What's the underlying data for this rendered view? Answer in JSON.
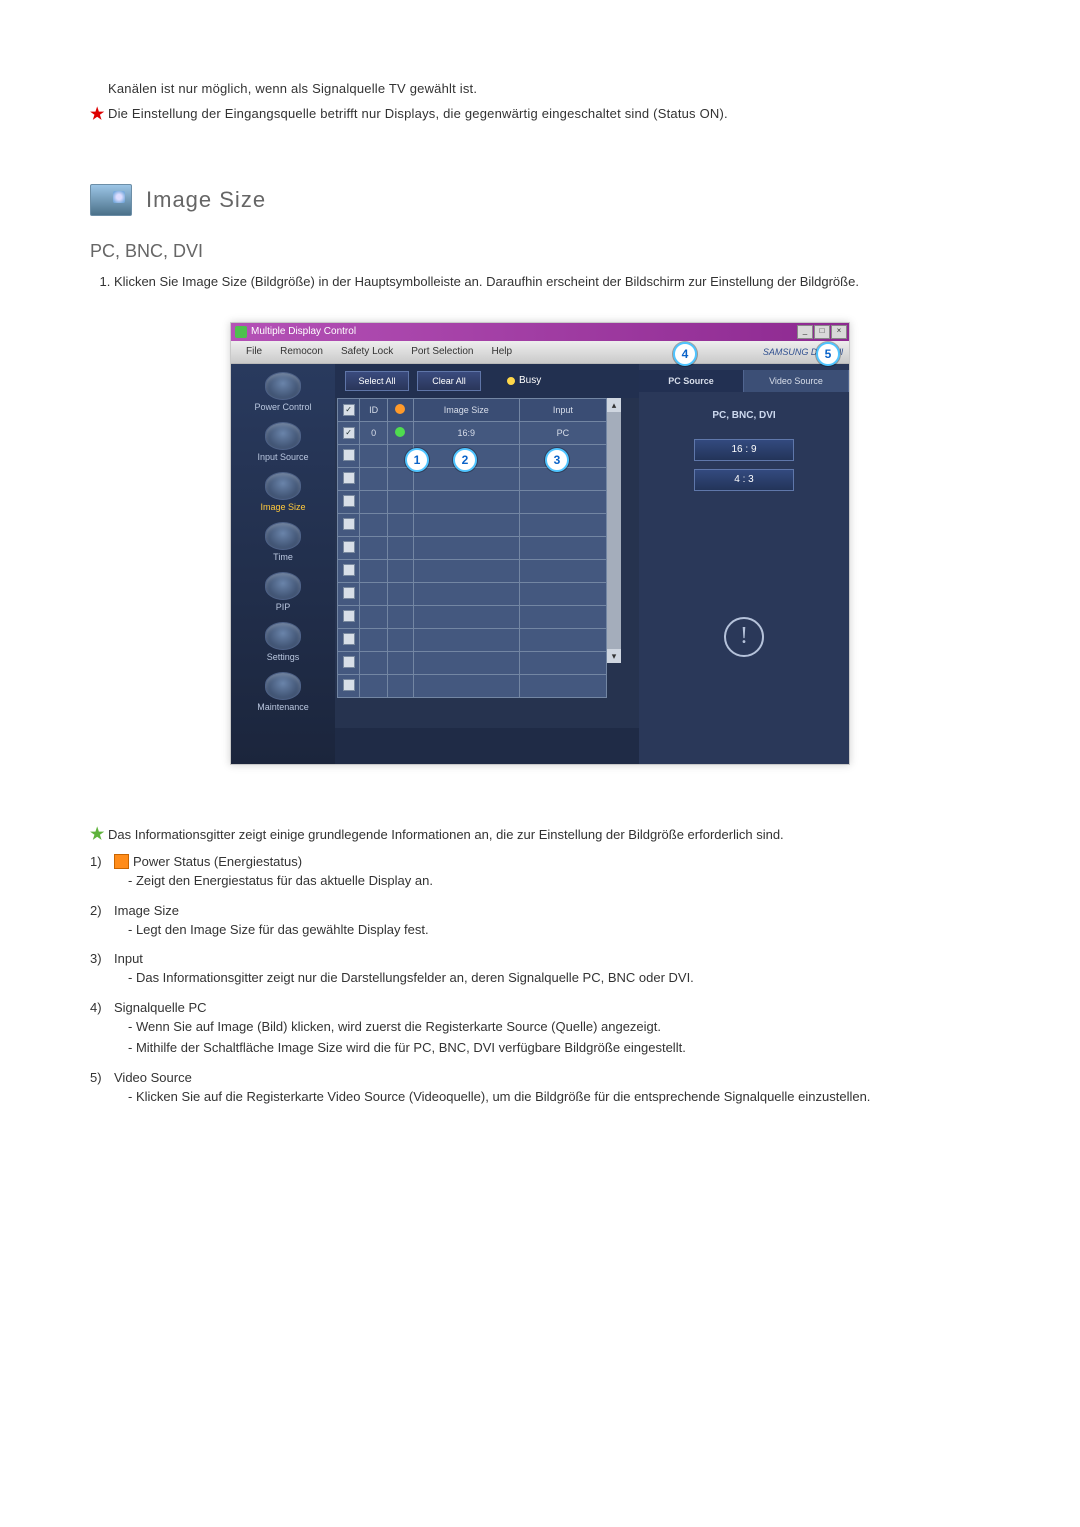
{
  "intro": {
    "line1": "Kanälen ist nur möglich, wenn als Signalquelle TV gewählt ist.",
    "line2": "Die Einstellung der Eingangsquelle betrifft nur Displays, die gegenwärtig eingeschaltet sind (Status ON)."
  },
  "section": {
    "title": "Image Size",
    "subhead": "PC, BNC, DVI",
    "step1": "Klicken Sie Image Size (Bildgröße) in der Hauptsymbolleiste an. Daraufhin erscheint der Bildschirm zur Einstellung der Bildgröße."
  },
  "mock": {
    "title": "Multiple Display Control",
    "menu": [
      "File",
      "Remocon",
      "Safety Lock",
      "Port Selection",
      "Help"
    ],
    "brand": "SAMSUNG DIGITall",
    "toolbar": {
      "select_all": "Select All",
      "clear_all": "Clear All",
      "busy": "Busy"
    },
    "sidebar": [
      {
        "label": "Power Control"
      },
      {
        "label": "Input Source"
      },
      {
        "label": "Image Size",
        "active": true
      },
      {
        "label": "Time"
      },
      {
        "label": "PIP"
      },
      {
        "label": "Settings"
      },
      {
        "label": "Maintenance"
      }
    ],
    "grid": {
      "headers": [
        "",
        "ID",
        "",
        "Image Size",
        "Input"
      ],
      "row": {
        "id": "0",
        "size": "16:9",
        "input": "PC"
      }
    },
    "callouts": {
      "c1": "1",
      "c2": "2",
      "c3": "3",
      "c4": "4",
      "c5": "5"
    },
    "tabs": {
      "pc": "PC Source",
      "video": "Video Source"
    },
    "source_label": "PC, BNC, DVI",
    "ratios": [
      "16 : 9",
      "4 : 3"
    ]
  },
  "desc": {
    "info": "Das Informationsgitter zeigt einige grundlegende Informationen an, die zur Einstellung der Bildgröße erforderlich sind.",
    "items": [
      {
        "num": "1)",
        "title": "Power Status (Energiestatus)",
        "icon": true,
        "lines": [
          "Zeigt den Energiestatus für das aktuelle Display an."
        ]
      },
      {
        "num": "2)",
        "title": "Image Size",
        "lines": [
          "Legt den Image Size für das gewählte Display fest."
        ]
      },
      {
        "num": "3)",
        "title": "Input",
        "lines": [
          "Das Informationsgitter zeigt nur die Darstellungsfelder an, deren Signalquelle PC, BNC oder DVI."
        ]
      },
      {
        "num": "4)",
        "title": "Signalquelle PC",
        "lines": [
          "Wenn Sie auf Image (Bild) klicken, wird zuerst die Registerkarte Source (Quelle) angezeigt.",
          "Mithilfe der Schaltfläche Image Size wird die für PC, BNC, DVI verfügbare Bildgröße eingestellt."
        ]
      },
      {
        "num": "5)",
        "title": "Video Source",
        "lines": [
          "Klicken Sie auf die Registerkarte Video Source (Videoquelle), um die Bildgröße für die entsprechende Signalquelle einzustellen."
        ]
      }
    ]
  }
}
